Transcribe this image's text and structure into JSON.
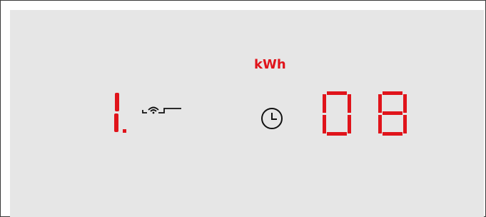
{
  "display": {
    "zone_number": "1",
    "unit_label": "kWh",
    "timer_value": "08",
    "accent_color": "#e0141b",
    "icons": {
      "mode": "wifi-wave-icon",
      "timer": "clock-icon"
    }
  }
}
